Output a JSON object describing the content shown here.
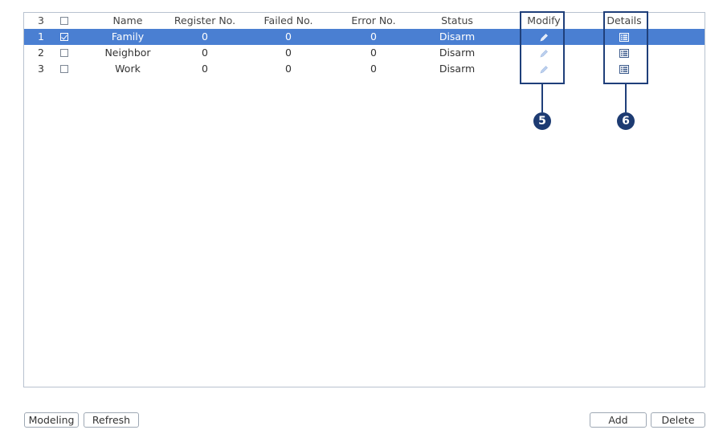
{
  "table": {
    "headers": {
      "count": "3",
      "name": "Name",
      "register_no": "Register No.",
      "failed_no": "Failed No.",
      "error_no": "Error No.",
      "status": "Status",
      "modify": "Modify",
      "details": "Details"
    },
    "rows": [
      {
        "index": "1",
        "checked": true,
        "name": "Family",
        "register_no": "0",
        "failed_no": "0",
        "error_no": "0",
        "status": "Disarm"
      },
      {
        "index": "2",
        "checked": false,
        "name": "Neighbor",
        "register_no": "0",
        "failed_no": "0",
        "error_no": "0",
        "status": "Disarm"
      },
      {
        "index": "3",
        "checked": false,
        "name": "Work",
        "register_no": "0",
        "failed_no": "0",
        "error_no": "0",
        "status": "Disarm"
      }
    ],
    "selected_row": 0
  },
  "callouts": {
    "modify_number": "5",
    "details_number": "6"
  },
  "buttons": {
    "modeling": "Modeling",
    "refresh": "Refresh",
    "add": "Add",
    "delete": "Delete"
  },
  "icons": {
    "modify": "pencil-icon",
    "details": "list-details-icon"
  },
  "colors": {
    "selected_row": "#4a7fd2",
    "callout": "#1f3f7a",
    "border": "#b8c2cf"
  }
}
